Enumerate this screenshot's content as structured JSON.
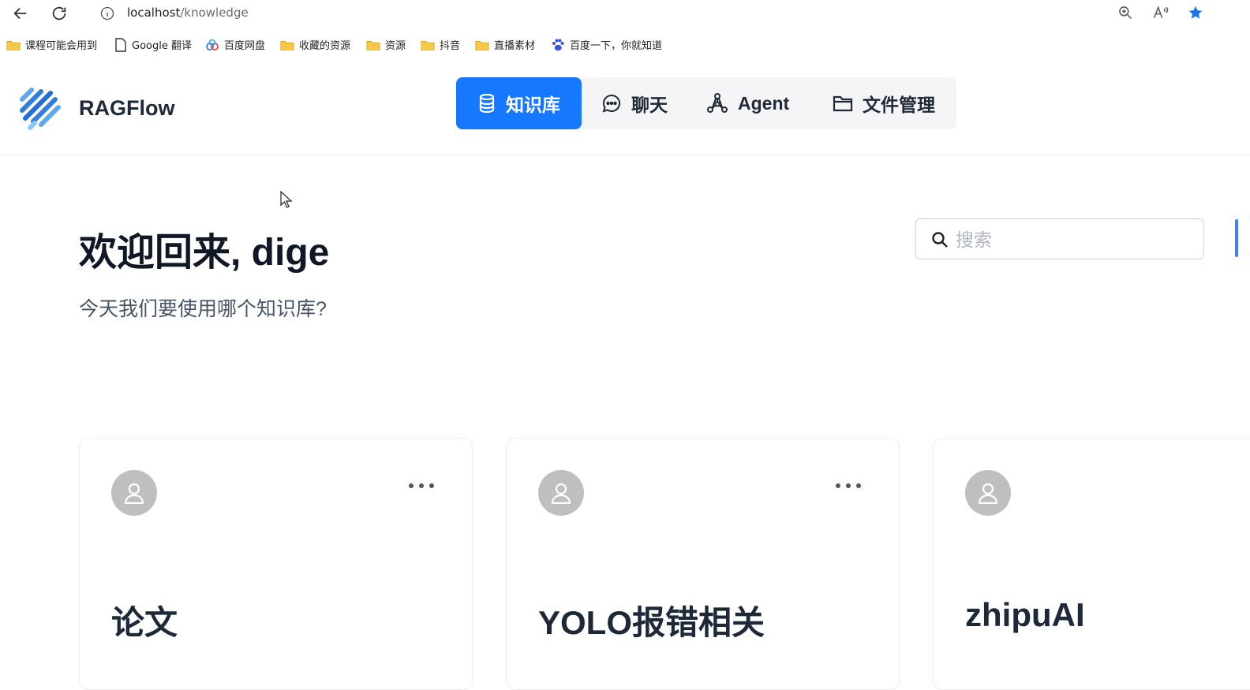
{
  "browser": {
    "url_host": "localhost",
    "url_path": "/knowledge",
    "bookmarks": [
      {
        "label": "课程可能会用到",
        "icon": "folder-icon"
      },
      {
        "label": "Google 翻译",
        "icon": "page-icon"
      },
      {
        "label": "百度网盘",
        "icon": "cloud-icon"
      },
      {
        "label": "收藏的资源",
        "icon": "folder-icon"
      },
      {
        "label": "资源",
        "icon": "folder-icon"
      },
      {
        "label": "抖音",
        "icon": "folder-icon"
      },
      {
        "label": "直播素材",
        "icon": "folder-icon"
      },
      {
        "label": "百度一下，你就知道",
        "icon": "paw-icon"
      }
    ]
  },
  "app": {
    "brand": "RAGFlow",
    "tabs": [
      {
        "label": "知识库",
        "icon": "database-icon",
        "active": true
      },
      {
        "label": "聊天",
        "icon": "chat-icon",
        "active": false
      },
      {
        "label": "Agent",
        "icon": "graph-icon",
        "active": false
      },
      {
        "label": "文件管理",
        "icon": "folder-icon",
        "active": false
      }
    ],
    "accent": "#1677ff"
  },
  "main": {
    "welcome": "欢迎回来, dige",
    "subtitle": "今天我们要使用哪个知识库?",
    "search_placeholder": "搜索",
    "cards": [
      {
        "title": "论文"
      },
      {
        "title": "YOLO报错相关"
      },
      {
        "title": "zhipuAI"
      }
    ]
  }
}
